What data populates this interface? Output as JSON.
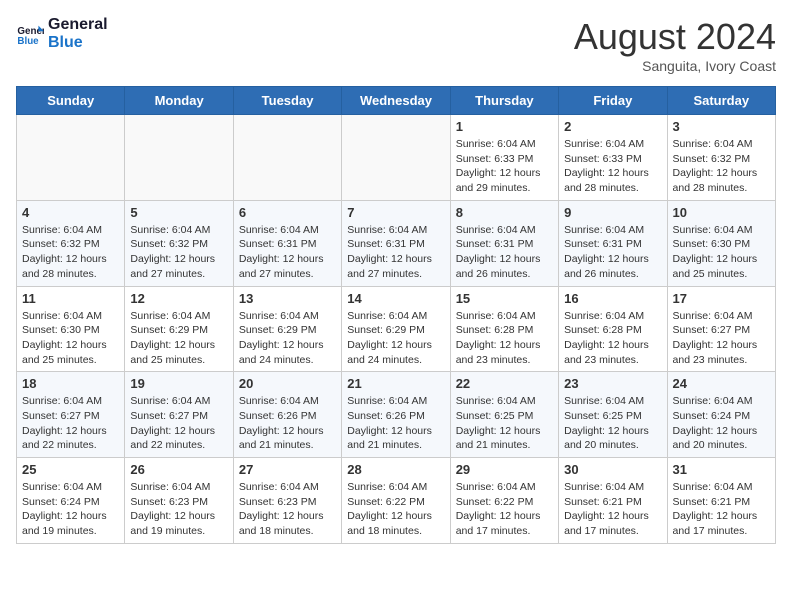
{
  "logo": {
    "line1": "General",
    "line2": "Blue"
  },
  "title": "August 2024",
  "subtitle": "Sanguita, Ivory Coast",
  "days_of_week": [
    "Sunday",
    "Monday",
    "Tuesday",
    "Wednesday",
    "Thursday",
    "Friday",
    "Saturday"
  ],
  "weeks": [
    [
      {
        "day": "",
        "info": ""
      },
      {
        "day": "",
        "info": ""
      },
      {
        "day": "",
        "info": ""
      },
      {
        "day": "",
        "info": ""
      },
      {
        "day": "1",
        "info": "Sunrise: 6:04 AM\nSunset: 6:33 PM\nDaylight: 12 hours\nand 29 minutes."
      },
      {
        "day": "2",
        "info": "Sunrise: 6:04 AM\nSunset: 6:33 PM\nDaylight: 12 hours\nand 28 minutes."
      },
      {
        "day": "3",
        "info": "Sunrise: 6:04 AM\nSunset: 6:32 PM\nDaylight: 12 hours\nand 28 minutes."
      }
    ],
    [
      {
        "day": "4",
        "info": "Sunrise: 6:04 AM\nSunset: 6:32 PM\nDaylight: 12 hours\nand 28 minutes."
      },
      {
        "day": "5",
        "info": "Sunrise: 6:04 AM\nSunset: 6:32 PM\nDaylight: 12 hours\nand 27 minutes."
      },
      {
        "day": "6",
        "info": "Sunrise: 6:04 AM\nSunset: 6:31 PM\nDaylight: 12 hours\nand 27 minutes."
      },
      {
        "day": "7",
        "info": "Sunrise: 6:04 AM\nSunset: 6:31 PM\nDaylight: 12 hours\nand 27 minutes."
      },
      {
        "day": "8",
        "info": "Sunrise: 6:04 AM\nSunset: 6:31 PM\nDaylight: 12 hours\nand 26 minutes."
      },
      {
        "day": "9",
        "info": "Sunrise: 6:04 AM\nSunset: 6:31 PM\nDaylight: 12 hours\nand 26 minutes."
      },
      {
        "day": "10",
        "info": "Sunrise: 6:04 AM\nSunset: 6:30 PM\nDaylight: 12 hours\nand 25 minutes."
      }
    ],
    [
      {
        "day": "11",
        "info": "Sunrise: 6:04 AM\nSunset: 6:30 PM\nDaylight: 12 hours\nand 25 minutes."
      },
      {
        "day": "12",
        "info": "Sunrise: 6:04 AM\nSunset: 6:29 PM\nDaylight: 12 hours\nand 25 minutes."
      },
      {
        "day": "13",
        "info": "Sunrise: 6:04 AM\nSunset: 6:29 PM\nDaylight: 12 hours\nand 24 minutes."
      },
      {
        "day": "14",
        "info": "Sunrise: 6:04 AM\nSunset: 6:29 PM\nDaylight: 12 hours\nand 24 minutes."
      },
      {
        "day": "15",
        "info": "Sunrise: 6:04 AM\nSunset: 6:28 PM\nDaylight: 12 hours\nand 23 minutes."
      },
      {
        "day": "16",
        "info": "Sunrise: 6:04 AM\nSunset: 6:28 PM\nDaylight: 12 hours\nand 23 minutes."
      },
      {
        "day": "17",
        "info": "Sunrise: 6:04 AM\nSunset: 6:27 PM\nDaylight: 12 hours\nand 23 minutes."
      }
    ],
    [
      {
        "day": "18",
        "info": "Sunrise: 6:04 AM\nSunset: 6:27 PM\nDaylight: 12 hours\nand 22 minutes."
      },
      {
        "day": "19",
        "info": "Sunrise: 6:04 AM\nSunset: 6:27 PM\nDaylight: 12 hours\nand 22 minutes."
      },
      {
        "day": "20",
        "info": "Sunrise: 6:04 AM\nSunset: 6:26 PM\nDaylight: 12 hours\nand 21 minutes."
      },
      {
        "day": "21",
        "info": "Sunrise: 6:04 AM\nSunset: 6:26 PM\nDaylight: 12 hours\nand 21 minutes."
      },
      {
        "day": "22",
        "info": "Sunrise: 6:04 AM\nSunset: 6:25 PM\nDaylight: 12 hours\nand 21 minutes."
      },
      {
        "day": "23",
        "info": "Sunrise: 6:04 AM\nSunset: 6:25 PM\nDaylight: 12 hours\nand 20 minutes."
      },
      {
        "day": "24",
        "info": "Sunrise: 6:04 AM\nSunset: 6:24 PM\nDaylight: 12 hours\nand 20 minutes."
      }
    ],
    [
      {
        "day": "25",
        "info": "Sunrise: 6:04 AM\nSunset: 6:24 PM\nDaylight: 12 hours\nand 19 minutes."
      },
      {
        "day": "26",
        "info": "Sunrise: 6:04 AM\nSunset: 6:23 PM\nDaylight: 12 hours\nand 19 minutes."
      },
      {
        "day": "27",
        "info": "Sunrise: 6:04 AM\nSunset: 6:23 PM\nDaylight: 12 hours\nand 18 minutes."
      },
      {
        "day": "28",
        "info": "Sunrise: 6:04 AM\nSunset: 6:22 PM\nDaylight: 12 hours\nand 18 minutes."
      },
      {
        "day": "29",
        "info": "Sunrise: 6:04 AM\nSunset: 6:22 PM\nDaylight: 12 hours\nand 17 minutes."
      },
      {
        "day": "30",
        "info": "Sunrise: 6:04 AM\nSunset: 6:21 PM\nDaylight: 12 hours\nand 17 minutes."
      },
      {
        "day": "31",
        "info": "Sunrise: 6:04 AM\nSunset: 6:21 PM\nDaylight: 12 hours\nand 17 minutes."
      }
    ]
  ]
}
